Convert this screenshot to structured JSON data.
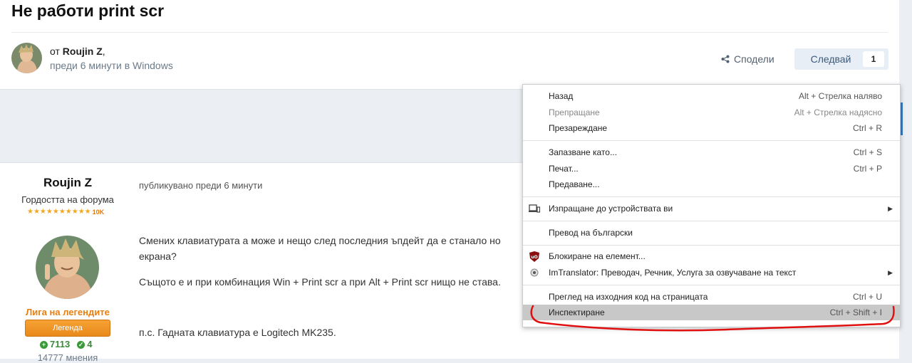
{
  "topic": {
    "title": "Не работи print scr",
    "author_prefix": "от",
    "author_name": "Roujin Z",
    "author_suffix": ",",
    "date_line": "преди 6 минути в Windows",
    "share_label": "Сподели",
    "follow_label": "Следвай",
    "follow_count": "1"
  },
  "post": {
    "author_name": "Roujin Z",
    "author_rank": "Гордостта на форума",
    "stars_count": "10K",
    "group_title": "Лига на легендите",
    "badge_label": "Легенда",
    "reputation_plus": "7113",
    "reputation_solutions": "4",
    "posts_count": "14777 мнения",
    "posted_time": "публикувано преди 6 минути",
    "line1": "Смених клавиатурата а може и нещо след последния ъпдейт да е станало но ",
    "line2": "екрана?",
    "line3": "Същото е и при комбинация Win + Print scr а при Alt + Print scr нищо не става.",
    "line4": "п.с. Гадната клавиатура е Logitech MK235."
  },
  "context_menu": {
    "items": [
      {
        "label": "Назад",
        "shortcut": "Alt + Стрелка наляво",
        "disabled": false
      },
      {
        "label": "Препращане",
        "shortcut": "Alt + Стрелка надясно",
        "disabled": true
      },
      {
        "label": "Презареждане",
        "shortcut": "Ctrl + R",
        "disabled": false
      },
      {
        "label": "Запазване като...",
        "shortcut": "Ctrl + S",
        "disabled": false
      },
      {
        "label": "Печат...",
        "shortcut": "Ctrl + P",
        "disabled": false
      },
      {
        "label": "Предаване...",
        "shortcut": "",
        "disabled": false
      },
      {
        "label": "Изпращане до устройствата ви",
        "shortcut": "",
        "disabled": false,
        "submenu": true,
        "icon": "devices-icon"
      },
      {
        "label": "Превод на български",
        "shortcut": "",
        "disabled": false
      },
      {
        "label": "Блокиране на елемент...",
        "shortcut": "",
        "disabled": false,
        "icon": "ublock-icon"
      },
      {
        "label": "ImTranslator: Преводач, Речник, Услуга за озвучаване на текст",
        "shortcut": "",
        "disabled": false,
        "submenu": true,
        "icon": "imtranslator-icon"
      },
      {
        "label": "Преглед на изходния код на страницата",
        "shortcut": "Ctrl + U",
        "disabled": false
      },
      {
        "label": "Инспектиране",
        "shortcut": "Ctrl + Shift + I",
        "disabled": false,
        "highlighted": true
      }
    ]
  },
  "colors": {
    "accent_orange": "#e87f10",
    "annotation_red": "#e01010",
    "menu_highlight": "#c8c8c8"
  }
}
